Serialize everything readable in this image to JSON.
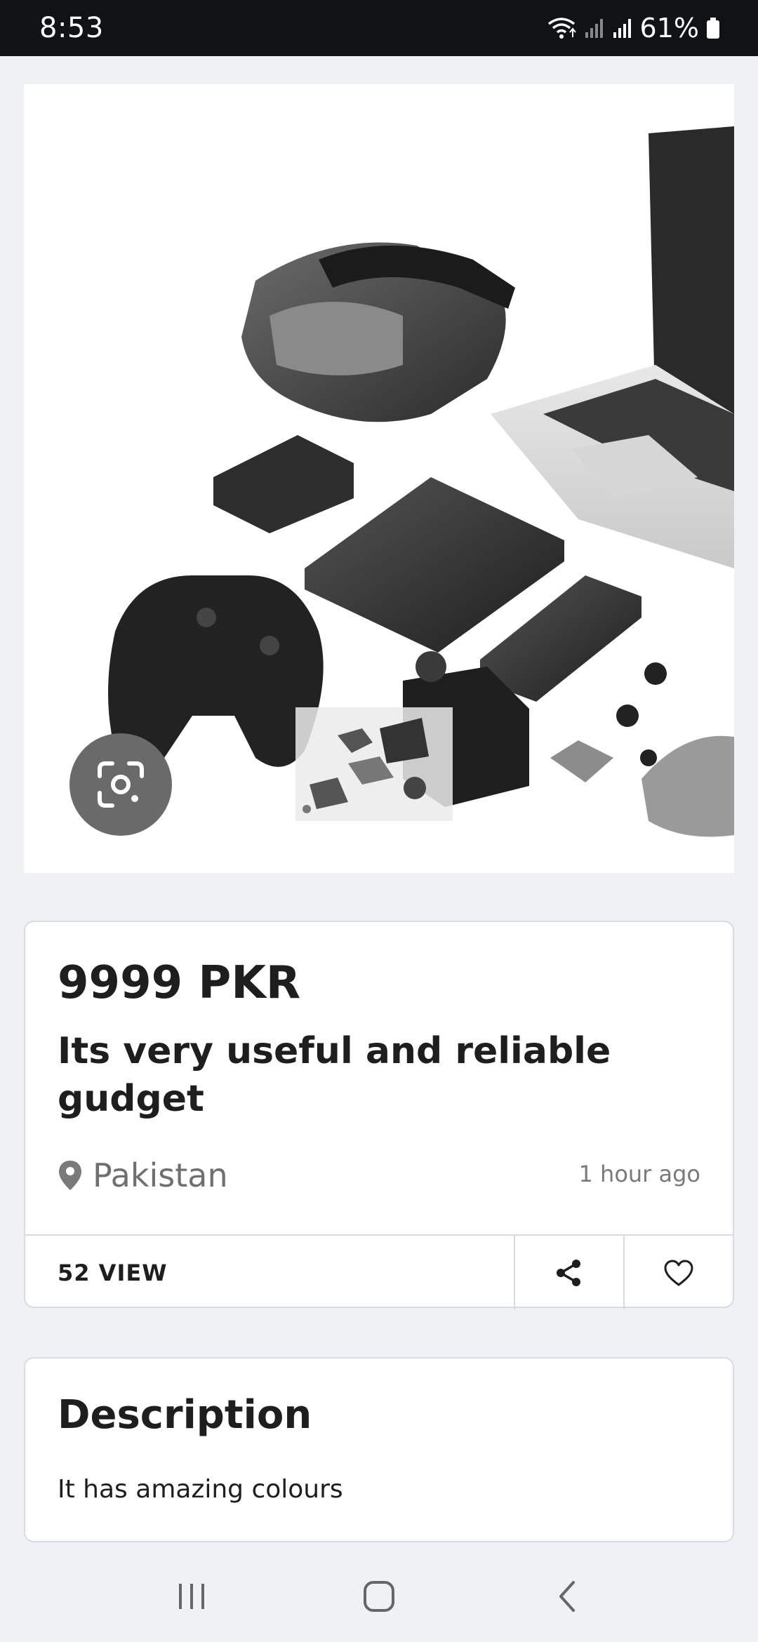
{
  "status_bar": {
    "time": "8:53",
    "battery": "61%",
    "icons": [
      "wifi-icon",
      "signal-icon",
      "signal-icon",
      "battery-icon"
    ]
  },
  "listing": {
    "price": "9999 PKR",
    "title": "Its very useful and reliable gudget",
    "location": "Pakistan",
    "posted": "1 hour ago",
    "views": "52 VIEW"
  },
  "description": {
    "heading": "Description",
    "text": "It has amazing colours"
  },
  "image": {
    "icons": [
      "camera-lens-icon"
    ]
  },
  "colors": {
    "background": "#eff1f5",
    "card_border": "#d9dbe0",
    "text": "#1e1e1e",
    "muted": "#6f6f6f"
  }
}
